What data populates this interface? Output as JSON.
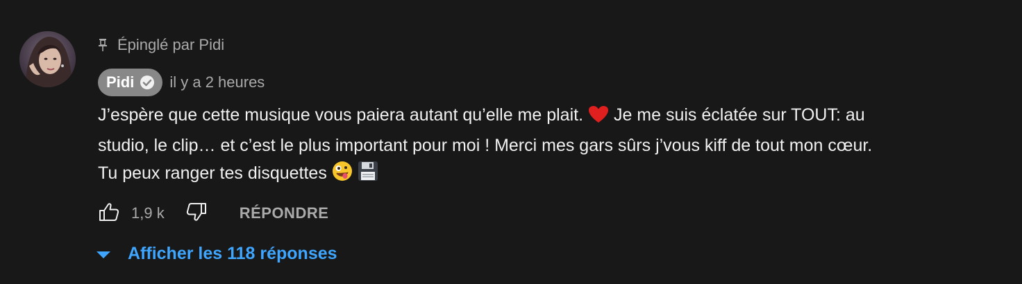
{
  "pinned": {
    "label": "Épinglé par Pidi",
    "icon": "pin-icon"
  },
  "author": {
    "name": "Pidi",
    "verified_icon": "verified-check-icon",
    "timestamp": "il y a 2 heures"
  },
  "comment": {
    "line1_part1": "J’espère que cette musique vous paiera autant qu’elle me plait.",
    "line1_part2": "Je me suis éclatée sur TOUT: au",
    "line2": "studio, le clip… et c’est le plus important pour moi ! Merci mes gars sûrs j’vous kiff de tout mon cœur.",
    "line3": "Tu peux ranger tes disquettes",
    "emojis": [
      "red-heart-emoji",
      "zany-face-emoji",
      "floppy-disk-emoji"
    ]
  },
  "actions": {
    "like_count": "1,9 k",
    "reply_label": "RÉPONDRE",
    "like_icon": "thumbs-up-icon",
    "dislike_icon": "thumbs-down-icon"
  },
  "replies": {
    "label": "Afficher les 118 réponses",
    "icon": "caret-down-icon"
  },
  "colors": {
    "background": "#181818",
    "text": "#f1f1f1",
    "secondary": "#aaaaaa",
    "link": "#3ea6ff",
    "chip": "#888888"
  }
}
